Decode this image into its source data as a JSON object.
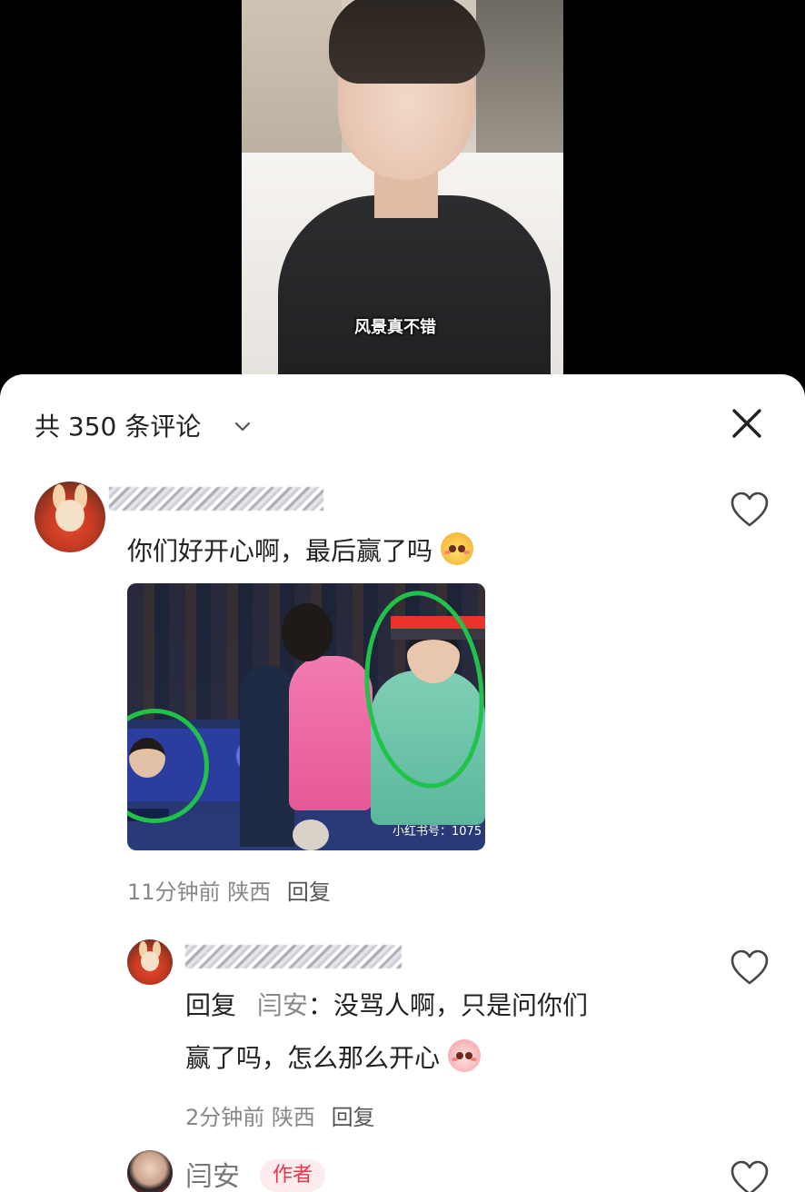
{
  "video": {
    "caption": "风景真不错"
  },
  "comments_panel": {
    "title": "共 350 条评论",
    "chevron_icon": "chevron-down",
    "close_icon": "close-x"
  },
  "comments": [
    {
      "username": "",
      "text": "你们好开心啊，最后赢了吗",
      "emoji": "pineapple-face-emoji",
      "photo_watermark": "小红书号：1075",
      "time": "11分钟前",
      "location": "陕西",
      "reply_label": "回复"
    }
  ],
  "reply": {
    "username": "",
    "prefix": "回复",
    "reply_to": "闫安",
    "colon": "：",
    "text_line1": "没骂人啊，只是问你们",
    "text_line2": "赢了吗，怎么那么开心",
    "emoji": "peach-face-emoji",
    "time": "2分钟前",
    "location": "陕西",
    "reply_label": "回复"
  },
  "author_comment": {
    "username": "闫安",
    "badge": "作者"
  },
  "colors": {
    "accent_badge": "#e8344a",
    "badge_bg": "#fdecee",
    "muted": "#888888"
  }
}
